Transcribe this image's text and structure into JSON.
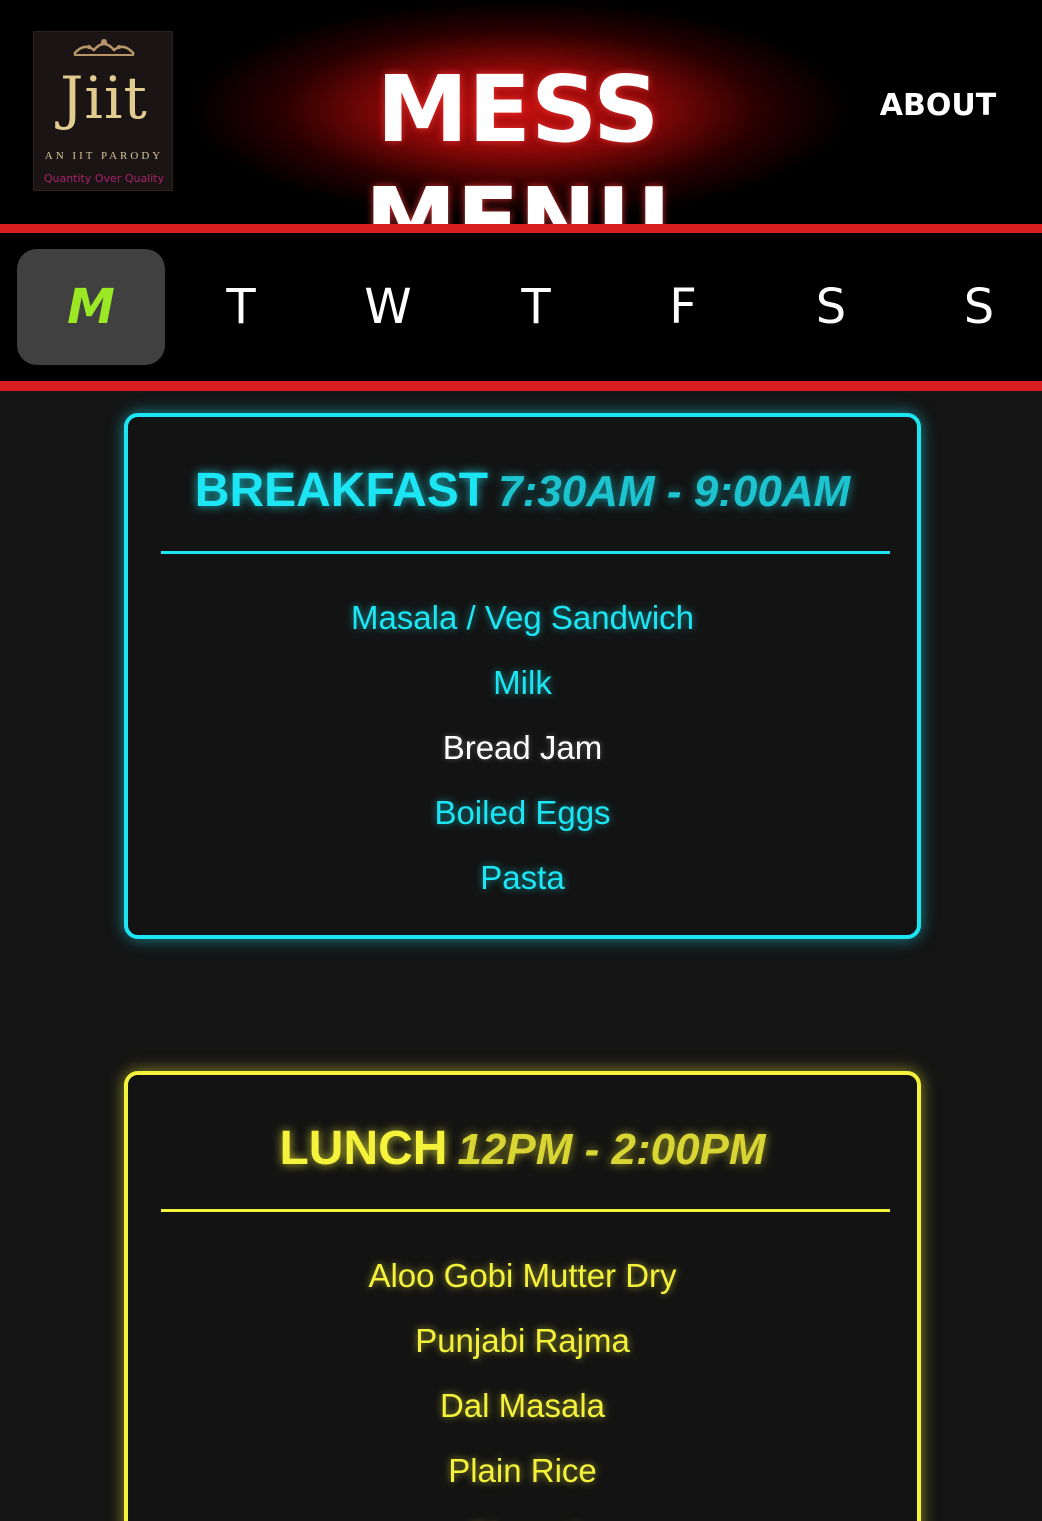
{
  "header": {
    "logo": {
      "word": "Jiit",
      "subtitle": "AN IIT PARODY",
      "tagline": "Quantity Over Quality"
    },
    "title": "MESS MENU",
    "about_label": "ABOUT"
  },
  "days": [
    {
      "label": "M",
      "active": true
    },
    {
      "label": "T",
      "active": false
    },
    {
      "label": "W",
      "active": false
    },
    {
      "label": "T",
      "active": false
    },
    {
      "label": "F",
      "active": false
    },
    {
      "label": "S",
      "active": false
    },
    {
      "label": "S",
      "active": false
    }
  ],
  "meals": {
    "breakfast": {
      "name": "BREAKFAST",
      "time": "7:30AM - 9:00AM",
      "accent": "#1de6f4",
      "items": [
        "Masala / Veg Sandwich",
        "Milk",
        "Bread Jam",
        "Boiled Eggs",
        "Pasta"
      ]
    },
    "lunch": {
      "name": "LUNCH",
      "time": "12PM - 2:00PM",
      "accent": "#f4f23a",
      "items": [
        "Aloo Gobi Mutter Dry",
        "Punjabi Rajma",
        "Dal Masala",
        "Plain Rice",
        "Chapati"
      ]
    }
  },
  "colors": {
    "header_red": "#c41010",
    "divider_red": "#d81e1e",
    "active_day": "#9be825",
    "background": "#141414"
  }
}
